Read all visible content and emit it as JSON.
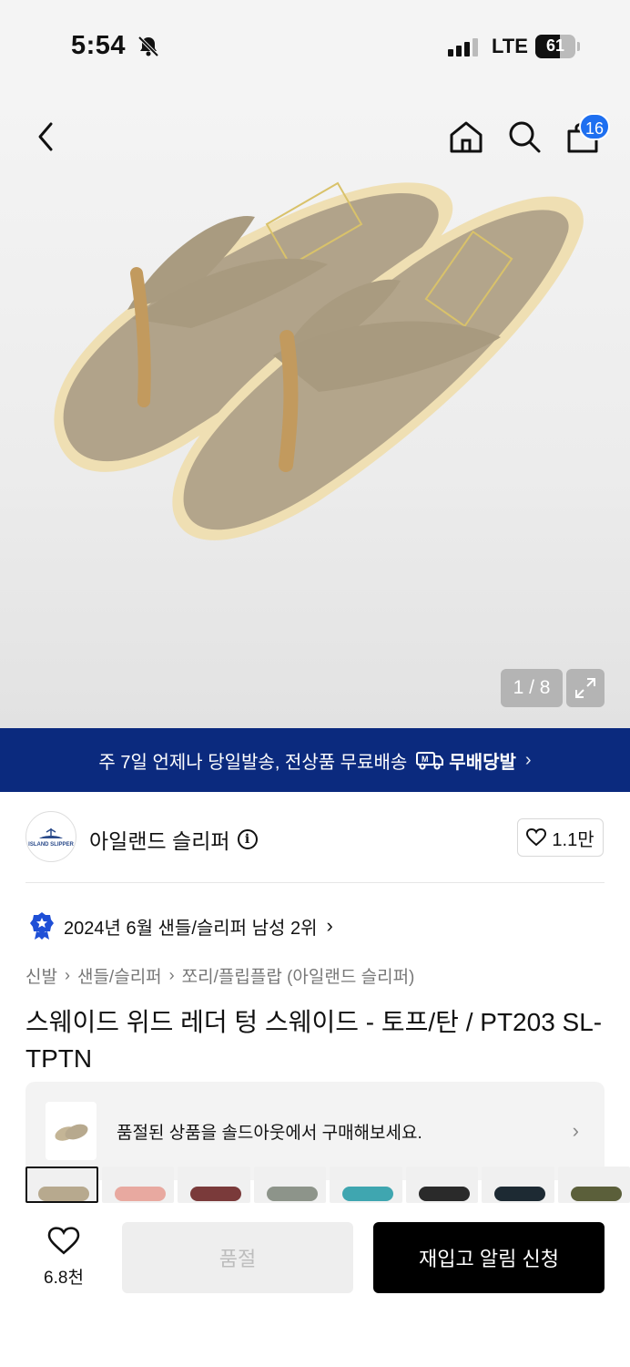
{
  "status_bar": {
    "time": "5:54",
    "network": "LTE",
    "battery": "61",
    "battery_level": 0.61
  },
  "nav": {
    "cart_count": "16"
  },
  "gallery": {
    "counter": "1 / 8"
  },
  "promo": {
    "text": "주 7일 언제나 당일발송, 전상품 무료배송",
    "brand": "무배당발"
  },
  "store": {
    "name": "아일랜드 슬리퍼",
    "logo_text": "ISLAND SLIPPER",
    "likes": "1.1만"
  },
  "ranking": {
    "text": "2024년 6월 샌들/슬리퍼 남성 2위"
  },
  "breadcrumb": [
    "신발",
    "샌들/슬리퍼",
    "쪼리/플립플랍 (아일랜드 슬리퍼)"
  ],
  "product": {
    "title": "스웨이드 위드 레더 텅 스웨이드 - 토프/탄 / PT203 SL-TPTN"
  },
  "soldout_card": {
    "text": "품절된 상품을 솔드아웃에서 구매해보세요."
  },
  "color_swatches": [
    "#b7a98e",
    "#e8a9a0",
    "#7a3a3a",
    "#8d948a",
    "#3fa6b0",
    "#2a2a2a",
    "#1d2a33",
    "#5b5f3a"
  ],
  "bottom_bar": {
    "wish_count": "6.8천",
    "soldout_label": "품절",
    "notify_label": "재입고 알림 신청"
  },
  "colors": {
    "promo_bg": "#0b2a7e",
    "badge": "#1e6ff0",
    "primary_button": "#000000"
  }
}
